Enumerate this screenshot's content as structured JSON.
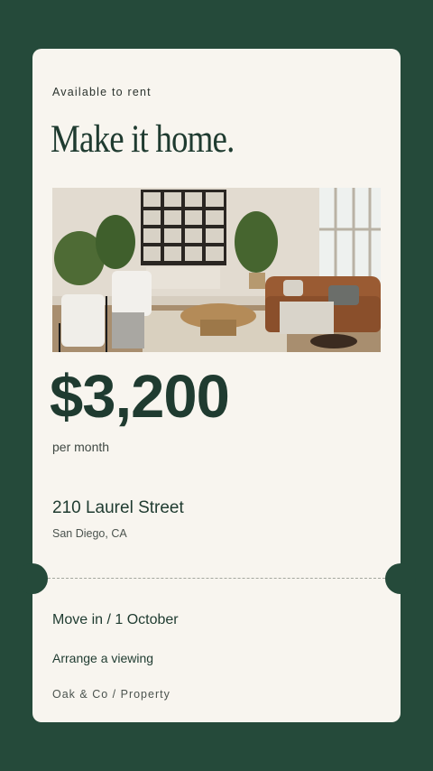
{
  "listing": {
    "eyebrow": "Available to rent",
    "headline": "Make it home.",
    "price": "$3,200",
    "price_period": "per month",
    "street": "210 Laurel Street",
    "city": "San Diego, CA",
    "move_in": "Move in / 1 October",
    "cta": "Arrange a viewing",
    "brand": "Oak & Co / Property"
  },
  "colors": {
    "background": "#254a3a",
    "card": "#f8f5ef",
    "ink": "#1f3b30"
  }
}
